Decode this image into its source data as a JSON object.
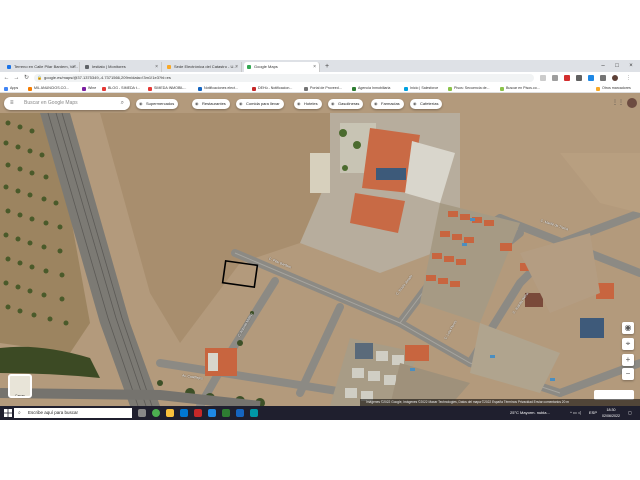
{
  "browser": {
    "tabs": [
      {
        "label": "Terreno en Calle Pilar Bardem, Va...",
        "favicon_color": "#1a73e8"
      },
      {
        "label": "Iestiato | Monitores",
        "favicon_color": "#5f6368"
      },
      {
        "label": "Sede Electrónica del Catastro - U...",
        "favicon_color": "#f9a825"
      },
      {
        "label": "Google Maps",
        "favicon_color": "#34a853"
      }
    ],
    "new_tab": "+",
    "url": "google.es/maps/@37.1375349,-4.7371566,209m/data=!3m1!1e3?hl=es",
    "bookmarks": [
      {
        "label": "Apps",
        "color": "#4285f4"
      },
      {
        "label": "MIL ANUNCIOS.CO...",
        "color": "#f57c00"
      },
      {
        "label": "Wine",
        "color": "#7b1fa2"
      },
      {
        "label": "BLOG - SIMEDA t...",
        "color": "#e53935"
      },
      {
        "label": "SIMEDA INMOBIL...",
        "color": "#e53935"
      },
      {
        "label": "Notificaciones elect...",
        "color": "#1565c0"
      },
      {
        "label": "DEHú - Notificacion...",
        "color": "#c62828"
      },
      {
        "label": "Portal de Proveed...",
        "color": "#757575"
      },
      {
        "label": "Agencia Inmobiliaria",
        "color": "#2e7d32"
      },
      {
        "label": "Inicio | Salesforce",
        "color": "#00a1e0"
      },
      {
        "label": "Pisos: Secuencia de...",
        "color": "#8bc34a"
      },
      {
        "label": "Buscar en Pisos.co...",
        "color": "#8bc34a"
      },
      {
        "label": "Otros marcadores",
        "color": "#f9a825"
      }
    ]
  },
  "maps": {
    "search_placeholder": "Buscar en Google Maps",
    "chips": [
      {
        "label": "Supermercados",
        "icon": "cart-icon"
      },
      {
        "label": "Restaurantes",
        "icon": "fork-knife-icon"
      },
      {
        "label": "Comida para llevar",
        "icon": "takeout-icon"
      },
      {
        "label": "Hoteles",
        "icon": "bed-icon"
      },
      {
        "label": "Gasolineras",
        "icon": "fuel-icon"
      },
      {
        "label": "Farmacias",
        "icon": "pharmacy-icon"
      },
      {
        "label": "Cafeterías",
        "icon": "coffee-icon"
      }
    ],
    "layers_label": "Capas",
    "road_labels": [
      "C. Pilar Bardem",
      "C. Antonio Molina",
      "Av. Castillejos",
      "C. Rocío Jurado",
      "C. Lola Flores",
      "C. Marifé de Triana",
      "C. Juanita Reina"
    ],
    "attribution": "Imágenes ©2022 Google, Imágenes ©2022 Maxar Technologies, Datos del mapa ©2022   España   Términos   Privacidad   Enviar comentarios   20 m"
  },
  "taskbar": {
    "search_placeholder": "Escribe aquí para buscar",
    "weather": "25°C  Mayorm. nubla...",
    "language": "ESP",
    "time": "18:30",
    "date": "02/06/2022"
  },
  "colors": {
    "field": "#b49c7f",
    "road": "#8a8a84",
    "taskbar": "#1f1f2e"
  }
}
